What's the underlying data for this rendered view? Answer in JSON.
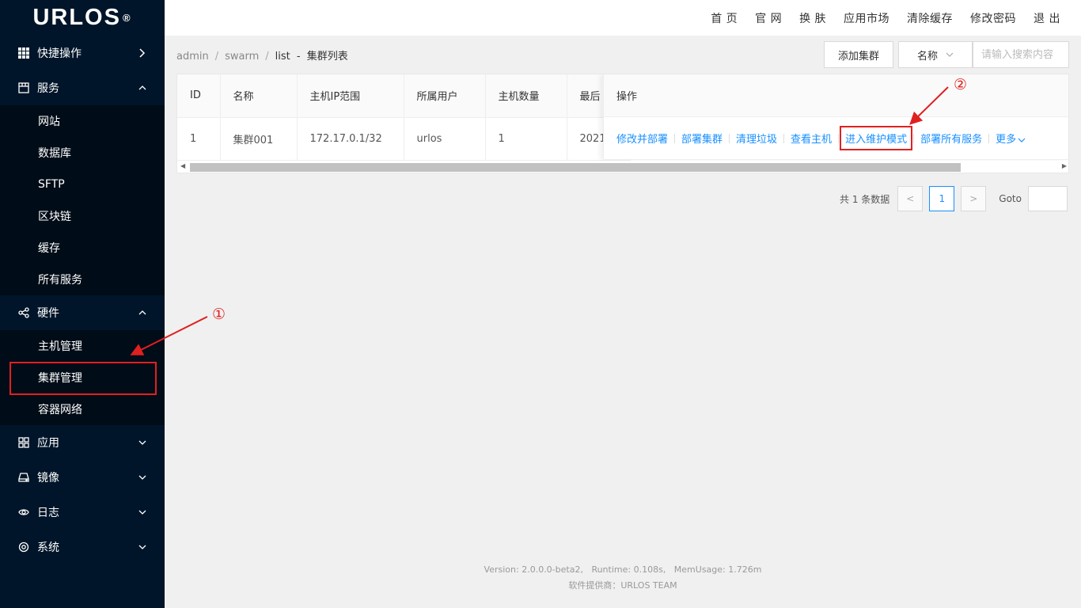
{
  "app": {
    "logo": "URLOS",
    "logo_mark": "®"
  },
  "topnav": [
    "首 页",
    "官 网",
    "换 肤",
    "应用市场",
    "清除缓存",
    "修改密码",
    "退 出"
  ],
  "sidebar": {
    "groups": [
      {
        "label": "快捷操作",
        "icon": "grid-icon",
        "arrow": "right"
      },
      {
        "label": "服务",
        "icon": "server-icon",
        "arrow": "up",
        "items": [
          "网站",
          "数据库",
          "SFTP",
          "区块链",
          "缓存",
          "所有服务"
        ]
      },
      {
        "label": "硬件",
        "icon": "share-icon",
        "arrow": "up",
        "items": [
          "主机管理",
          "集群管理",
          "容器网络"
        ]
      },
      {
        "label": "应用",
        "icon": "apps-icon",
        "arrow": "down"
      },
      {
        "label": "镜像",
        "icon": "drive-icon",
        "arrow": "down"
      },
      {
        "label": "日志",
        "icon": "eye-icon",
        "arrow": "down"
      },
      {
        "label": "系统",
        "icon": "settings-icon",
        "arrow": "down"
      }
    ]
  },
  "breadcrumb": {
    "p1": "admin",
    "p2": "swarm",
    "p3": "list",
    "dash": "-",
    "title": "集群列表"
  },
  "toolbar": {
    "add_label": "添加集群",
    "select_value": "名称",
    "search_placeholder": "请输入搜索内容"
  },
  "table": {
    "headers": {
      "id": "ID",
      "name": "名称",
      "ip": "主机IP范围",
      "user": "所属用户",
      "count": "主机数量",
      "last": "最后",
      "ops": "操作"
    },
    "row": {
      "id": "1",
      "name": "集群001",
      "ip": "172.17.0.1/32",
      "user": "urlos",
      "count": "1",
      "last": "2021"
    },
    "ops": [
      "修改并部署",
      "部署集群",
      "清理垃圾",
      "查看主机",
      "进入维护模式",
      "部署所有服务",
      "更多"
    ]
  },
  "pager": {
    "total": "共 1 条数据",
    "page": "1",
    "goto": "Goto"
  },
  "footer": {
    "line1": "Version: 2.0.0.0-beta2,   Runtime: 0.108s,   MemUsage: 1.726m",
    "line2": "软件提供商：URLOS TEAM"
  },
  "annotations": {
    "a1": "①",
    "a2": "②"
  }
}
